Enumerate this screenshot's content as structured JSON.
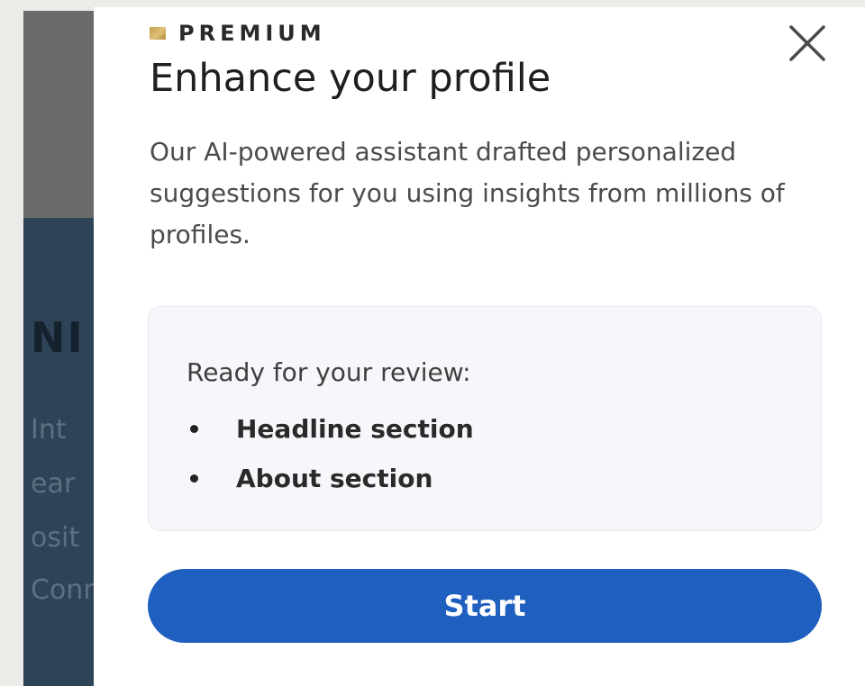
{
  "background": {
    "title_fragment": "NI",
    "lines": [
      "Int",
      "ear",
      "osit",
      "Conn"
    ]
  },
  "modal": {
    "premium_label": "PREMIUM",
    "title": "Enhance your profile",
    "description": "Our AI-powered assistant drafted personalized suggestions for you using insights from millions of profiles.",
    "review": {
      "heading": "Ready for your review:",
      "items": [
        "Headline section",
        "About section"
      ]
    },
    "start_label": "Start",
    "close_icon": "close-icon"
  },
  "colors": {
    "accent": "#1e5fbf",
    "premium_gold": "#c69d4a"
  }
}
